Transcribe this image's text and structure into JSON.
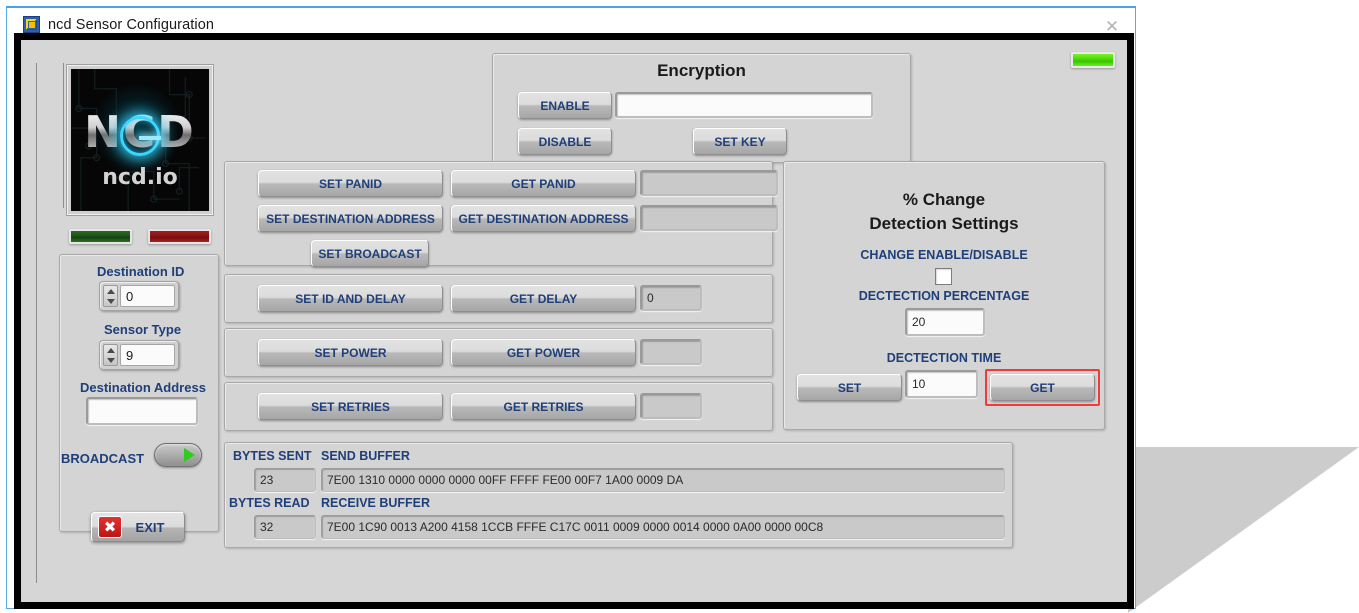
{
  "window": {
    "title": "ncd Sensor Configuration",
    "icon": "labview-icon",
    "close_label": "✕"
  },
  "logo": {
    "brand": "NCD",
    "domain": "ncd.io",
    "alt": "ncd-logo"
  },
  "status_leds": {
    "green_label": "green-status-led",
    "red_label": "red-status-led",
    "top_right_label": "activity-led"
  },
  "device": {
    "destination_id_label": "Destination ID",
    "destination_id_value": "0",
    "sensor_type_label": "Sensor Type",
    "sensor_type_value": "9",
    "destination_address_label": "Destination Address",
    "destination_address_value": "",
    "broadcast_label": "BROADCAST"
  },
  "encryption": {
    "title": "Encryption",
    "enable_label": "ENABLE",
    "disable_label": "DISABLE",
    "set_key_label": "SET KEY",
    "key_value": ""
  },
  "network": {
    "set_panid_label": "SET PANID",
    "get_panid_label": "GET PANID",
    "panid_value": "",
    "set_destination_address_label": "SET DESTINATION ADDRESS",
    "get_destination_address_label": "GET DESTINATION ADDRESS",
    "destination_address_value": "",
    "set_broadcast_label": "SET BROADCAST"
  },
  "delay": {
    "set_label": "SET ID AND DELAY",
    "get_label": "GET DELAY",
    "value": "0"
  },
  "power": {
    "set_label": "SET POWER",
    "get_label": "GET POWER",
    "value": ""
  },
  "retries": {
    "set_label": "SET RETRIES",
    "get_label": "GET RETRIES",
    "value": ""
  },
  "change_detection": {
    "title_line1": "% Change",
    "title_line2": "Detection Settings",
    "enable_disable_label": "CHANGE ENABLE/DISABLE",
    "enable_disable_checked": false,
    "percentage_label": "DECTECTION PERCENTAGE",
    "percentage_value": "20",
    "time_label": "DECTECTION TIME",
    "time_value": "10",
    "set_label": "SET",
    "get_label": "GET",
    "get_highlight_color": "#ef3b3b"
  },
  "buffers": {
    "bytes_sent_label": "BYTES SENT",
    "bytes_sent_value": "23",
    "send_buffer_label": "SEND BUFFER",
    "send_buffer_value": "7E00 1310 0000 0000 0000 00FF FFFF FE00 00F7 1A00 0009 DA",
    "bytes_read_label": "BYTES READ",
    "bytes_read_value": "32",
    "receive_buffer_label": "RECEIVE BUFFER",
    "receive_buffer_value": "7E00 1C90 0013 A200 4158 1CCB FFFE C17C 0011 0009 0000 0014 0000 0A00 0000 00C8"
  },
  "exit": {
    "label": "EXIT",
    "icon": "close-x-icon",
    "glyph": "✖"
  },
  "colors": {
    "accent_blue": "#1f3f7a",
    "panel_gray": "#d4d4d4",
    "led_green": "#4bdc09",
    "led_red": "#a41d1d",
    "highlight_red": "#ef3b3b"
  }
}
